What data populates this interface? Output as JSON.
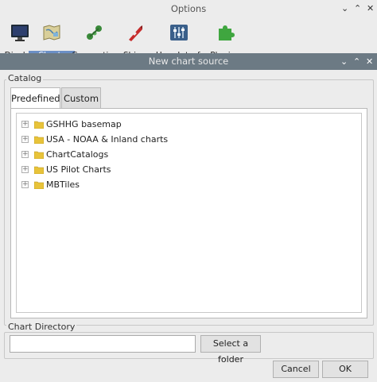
{
  "background_window": {
    "title": "Options",
    "toolbar": [
      {
        "label": "Display",
        "icon": "monitor-icon"
      },
      {
        "label": "Charts",
        "icon": "charts-icon"
      },
      {
        "label": "Connections",
        "icon": "connections-icon"
      },
      {
        "label": "Ships",
        "icon": "ship-icon"
      },
      {
        "label": "User Interface",
        "icon": "sliders-icon"
      },
      {
        "label": "Plugins",
        "icon": "puzzle-icon"
      }
    ],
    "active_tab": "Charts"
  },
  "dialog": {
    "title": "New chart source",
    "catalog": {
      "title": "Catalog",
      "tabs": [
        {
          "label": "Predefined",
          "selected": true
        },
        {
          "label": "Custom",
          "selected": false
        }
      ],
      "tree": [
        {
          "label": "GSHHG basemap"
        },
        {
          "label": "USA - NOAA & Inland charts"
        },
        {
          "label": "ChartCatalogs"
        },
        {
          "label": "US Pilot Charts"
        },
        {
          "label": "MBTiles"
        }
      ],
      "expander_glyph": "+"
    },
    "chart_directory": {
      "title": "Chart Directory",
      "value": "",
      "select_button": "Select a folder"
    },
    "buttons": {
      "cancel": "Cancel",
      "ok": "OK"
    }
  },
  "colors": {
    "dialog_titlebar": "#6c7a84",
    "active_tab_highlight": "#6b8fc6",
    "folder": "#e8c33a"
  }
}
